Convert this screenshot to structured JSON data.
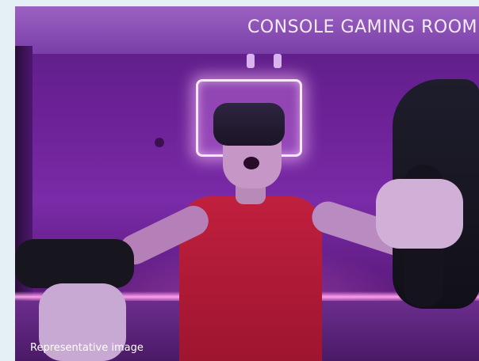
{
  "photo": {
    "title": "CONSOLE GAMING ROOM",
    "caption": "Representative image"
  },
  "colors": {
    "page_background": "#e4f0f5",
    "lighting_accent": "#b23cd8",
    "shirt": "#c0203d",
    "text": "#ffffff"
  }
}
